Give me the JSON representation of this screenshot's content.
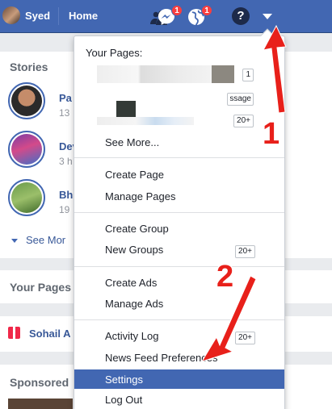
{
  "topbar": {
    "user_name": "Syed",
    "home_label": "Home",
    "friends_icon": "friends-icon",
    "messenger_icon": "messenger-icon",
    "messenger_badge": "1",
    "notifications_icon": "globe-icon",
    "notifications_badge": "1",
    "help_icon": "help-icon",
    "help_glyph": "?",
    "menu_icon": "caret-down-icon"
  },
  "left": {
    "stories_title": "Stories",
    "stories": [
      {
        "name": "Pa",
        "time": "13"
      },
      {
        "name": "Dev",
        "time": "3 h"
      },
      {
        "name": "Bh",
        "time": "19"
      }
    ],
    "see_more": "See Mor",
    "your_pages_title": "Your Pages",
    "page_name": "Sohail A",
    "sponsored_title": "Sponsored"
  },
  "menu": {
    "your_pages_label": "Your Pages:",
    "page1_count": "1",
    "page2_message_label": "ssage",
    "page2_count": "20+",
    "see_more": "See More...",
    "create_page": "Create Page",
    "manage_pages": "Manage Pages",
    "create_group": "Create Group",
    "new_groups": "New Groups",
    "new_groups_count": "20+",
    "create_ads": "Create Ads",
    "manage_ads": "Manage Ads",
    "activity_log": "Activity Log",
    "activity_log_count": "20+",
    "news_feed_preferences": "News Feed Preferences",
    "settings": "Settings",
    "log_out": "Log Out"
  },
  "annotations": {
    "step1": "1",
    "step2": "2",
    "color": "#e8201a"
  },
  "colors": {
    "brand": "#4267b2",
    "selected": "#4267b2",
    "badge": "#fa3e3e"
  }
}
